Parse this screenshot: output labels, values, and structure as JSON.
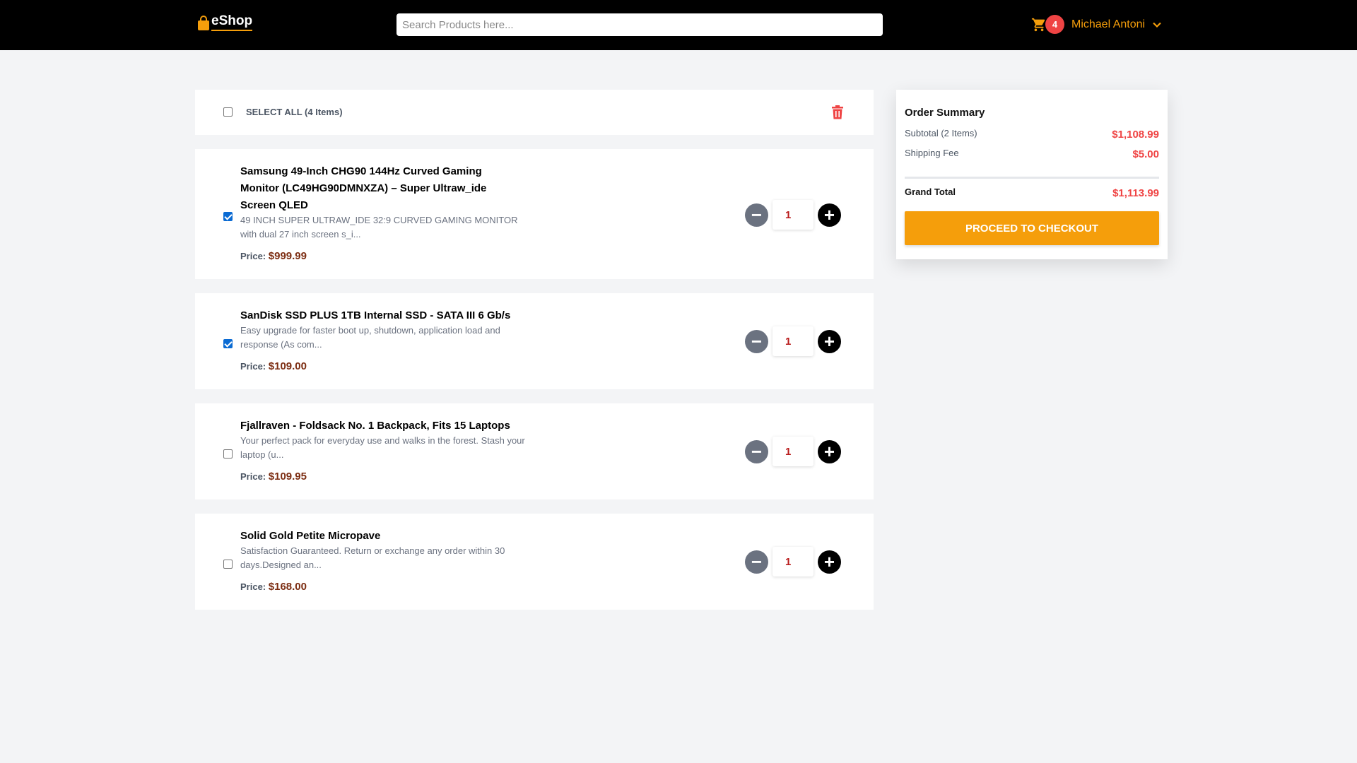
{
  "header": {
    "logo_text": "eShop",
    "search_placeholder": "Search Products here...",
    "cart_count": "4",
    "user_name": "Michael Antoni",
    "accent_color": "#f59e0b"
  },
  "cart": {
    "select_all_label": "SELECT ALL (4 Items)",
    "price_label": "Price:",
    "items": [
      {
        "checked": true,
        "title": "Samsung 49-Inch CHG90 144Hz Curved Gaming Monitor (LC49HG90DMNXZA) – Super Ultraw_ide Screen QLED",
        "description": "49 INCH SUPER ULTRAW_IDE 32:9 CURVED GAMING MONITOR with dual 27 inch screen s_i...",
        "price": "$999.99",
        "quantity": "1"
      },
      {
        "checked": true,
        "title": "SanDisk SSD PLUS 1TB Internal SSD - SATA III 6 Gb/s",
        "description": "Easy upgrade for faster boot up, shutdown, application load and response (As com...",
        "price": "$109.00",
        "quantity": "1"
      },
      {
        "checked": false,
        "title": "Fjallraven - Foldsack No. 1 Backpack, Fits 15 Laptops",
        "description": "Your perfect pack for everyday use and walks in the forest. Stash your laptop (u...",
        "price": "$109.95",
        "quantity": "1"
      },
      {
        "checked": false,
        "title": "Solid Gold Petite Micropave",
        "description": "Satisfaction Guaranteed. Return or exchange any order within 30 days.Designed an...",
        "price": "$168.00",
        "quantity": "1"
      }
    ]
  },
  "summary": {
    "title": "Order Summary",
    "subtotal_label": "Subtotal (2 Items)",
    "subtotal_value": "$1,108.99",
    "shipping_label": "Shipping Fee",
    "shipping_value": "$5.00",
    "grand_total_label": "Grand Total",
    "grand_total_value": "$1,113.99",
    "checkout_label": "PROCEED TO CHECKOUT"
  }
}
